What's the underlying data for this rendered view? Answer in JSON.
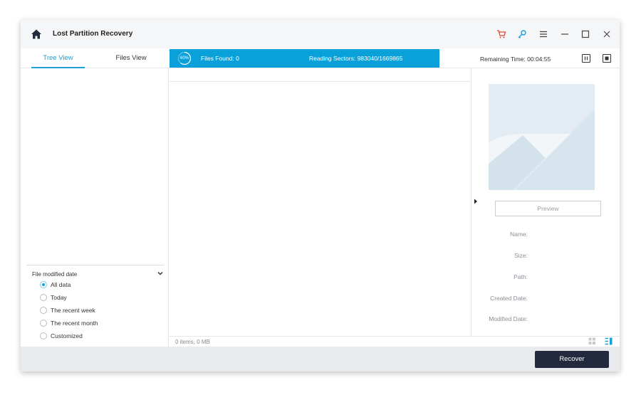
{
  "app": {
    "title": "Lost Partition Recovery"
  },
  "tabs": [
    {
      "label": "Tree View",
      "active": true
    },
    {
      "label": "Files View",
      "active": false
    }
  ],
  "scan": {
    "progress": 0.6,
    "progress_label": "60%",
    "files_found": "Files Found:  0",
    "reading_sectors": "Reading Sectors:  983040/1669865",
    "remaining_time": "Remaining Time: 00:04:55"
  },
  "filter": {
    "heading": "File modified date",
    "options": [
      {
        "label": "All data",
        "checked": true
      },
      {
        "label": "Today",
        "checked": false
      },
      {
        "label": "The recent week",
        "checked": false
      },
      {
        "label": "The recent month",
        "checked": false
      },
      {
        "label": "Customized",
        "checked": false
      }
    ]
  },
  "status": {
    "items": "0 items, 0 MB"
  },
  "preview": {
    "button": "Preview",
    "labels": [
      "Name:",
      "Size:",
      "Path:",
      "Created Date:",
      "Modified Date:"
    ]
  },
  "actions": {
    "recover": "Recover"
  },
  "colors": {
    "accent": "#0aa1da",
    "tab_active": "#1a9fd6",
    "recover_bg": "#232a3f",
    "cart": "#e0452e"
  }
}
